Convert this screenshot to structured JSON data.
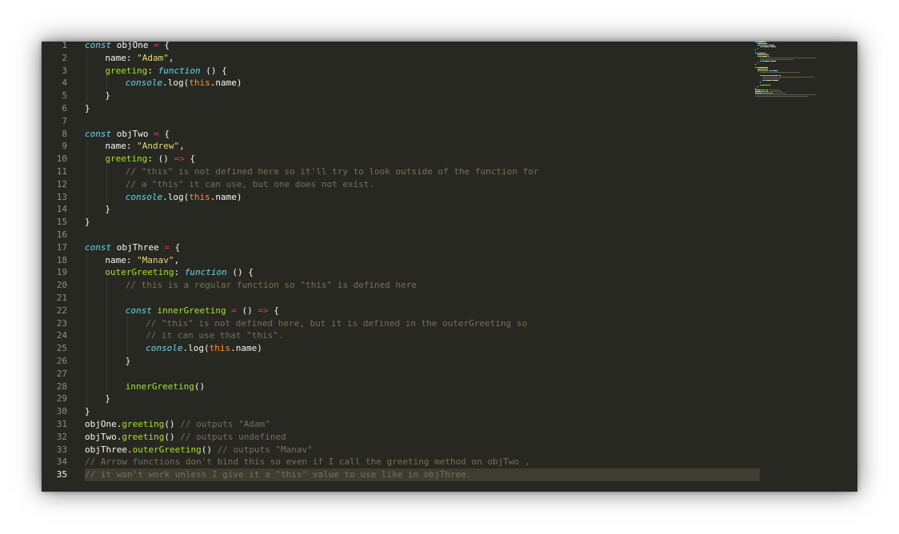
{
  "editor": {
    "current_line": 35,
    "lines": [
      {
        "n": "1",
        "indent": 0,
        "tokens": [
          [
            "kw",
            "const"
          ],
          [
            "t",
            " objOne "
          ],
          [
            "op",
            "="
          ],
          [
            "t",
            " {"
          ]
        ]
      },
      {
        "n": "2",
        "indent": 1,
        "tokens": [
          [
            "t",
            "name: "
          ],
          [
            "str",
            "\"Adam\""
          ],
          [
            "t",
            ","
          ]
        ]
      },
      {
        "n": "3",
        "indent": 1,
        "tokens": [
          [
            "prop",
            "greeting"
          ],
          [
            "t",
            ": "
          ],
          [
            "kw",
            "function"
          ],
          [
            "t",
            " () {"
          ]
        ]
      },
      {
        "n": "4",
        "indent": 2,
        "tokens": [
          [
            "con",
            "console"
          ],
          [
            "t",
            "."
          ],
          [
            "t",
            "log("
          ],
          [
            "this",
            "this"
          ],
          [
            "t",
            ".name)"
          ]
        ]
      },
      {
        "n": "5",
        "indent": 1,
        "tokens": [
          [
            "t",
            "}"
          ]
        ]
      },
      {
        "n": "6",
        "indent": 0,
        "tokens": [
          [
            "t",
            "}"
          ]
        ]
      },
      {
        "n": "7",
        "indent": 0,
        "tokens": []
      },
      {
        "n": "8",
        "indent": 0,
        "tokens": [
          [
            "kw",
            "const"
          ],
          [
            "t",
            " objTwo "
          ],
          [
            "op",
            "="
          ],
          [
            "t",
            " {"
          ]
        ]
      },
      {
        "n": "9",
        "indent": 1,
        "tokens": [
          [
            "t",
            "name: "
          ],
          [
            "str",
            "\"Andrew\""
          ],
          [
            "t",
            ","
          ]
        ]
      },
      {
        "n": "10",
        "indent": 1,
        "tokens": [
          [
            "prop",
            "greeting"
          ],
          [
            "t",
            ": () "
          ],
          [
            "op",
            "=>"
          ],
          [
            "t",
            " {"
          ]
        ]
      },
      {
        "n": "11",
        "indent": 2,
        "tokens": [
          [
            "com",
            "// \"this\" is not defined here so it'll try to look outside of the function for"
          ]
        ]
      },
      {
        "n": "12",
        "indent": 2,
        "tokens": [
          [
            "com",
            "// a \"this\" it can use, but one does not exist."
          ]
        ]
      },
      {
        "n": "13",
        "indent": 2,
        "tokens": [
          [
            "con",
            "console"
          ],
          [
            "t",
            "."
          ],
          [
            "t",
            "log("
          ],
          [
            "this",
            "this"
          ],
          [
            "t",
            ".name)"
          ]
        ]
      },
      {
        "n": "14",
        "indent": 1,
        "tokens": [
          [
            "t",
            "}"
          ]
        ]
      },
      {
        "n": "15",
        "indent": 0,
        "tokens": [
          [
            "t",
            "}"
          ]
        ]
      },
      {
        "n": "16",
        "indent": 0,
        "tokens": []
      },
      {
        "n": "17",
        "indent": 0,
        "tokens": [
          [
            "kw",
            "const"
          ],
          [
            "t",
            " objThree "
          ],
          [
            "op",
            "="
          ],
          [
            "t",
            " {"
          ]
        ]
      },
      {
        "n": "18",
        "indent": 1,
        "tokens": [
          [
            "t",
            "name: "
          ],
          [
            "str",
            "\"Manav\""
          ],
          [
            "t",
            ","
          ]
        ]
      },
      {
        "n": "19",
        "indent": 1,
        "tokens": [
          [
            "prop",
            "outerGreeting"
          ],
          [
            "t",
            ": "
          ],
          [
            "kw",
            "function"
          ],
          [
            "t",
            " () {"
          ]
        ]
      },
      {
        "n": "20",
        "indent": 2,
        "tokens": [
          [
            "com",
            "// this is a regular function so \"this\" is defined here"
          ]
        ]
      },
      {
        "n": "21",
        "indent": 0,
        "tokens": []
      },
      {
        "n": "22",
        "indent": 2,
        "tokens": [
          [
            "kw",
            "const"
          ],
          [
            "t",
            " "
          ],
          [
            "fn",
            "innerGreeting"
          ],
          [
            "t",
            " "
          ],
          [
            "op",
            "="
          ],
          [
            "t",
            " () "
          ],
          [
            "op",
            "=>"
          ],
          [
            "t",
            " {"
          ]
        ]
      },
      {
        "n": "23",
        "indent": 3,
        "tokens": [
          [
            "com",
            "// \"this\" is not defined here, but it is defined in the outerGreeting so"
          ]
        ]
      },
      {
        "n": "24",
        "indent": 3,
        "tokens": [
          [
            "com",
            "// it can use that \"this\"."
          ]
        ]
      },
      {
        "n": "25",
        "indent": 3,
        "tokens": [
          [
            "con",
            "console"
          ],
          [
            "t",
            "."
          ],
          [
            "t",
            "log("
          ],
          [
            "this",
            "this"
          ],
          [
            "t",
            ".name)"
          ]
        ]
      },
      {
        "n": "26",
        "indent": 2,
        "tokens": [
          [
            "t",
            "}"
          ]
        ]
      },
      {
        "n": "27",
        "indent": 0,
        "tokens": []
      },
      {
        "n": "28",
        "indent": 2,
        "tokens": [
          [
            "fn",
            "innerGreeting"
          ],
          [
            "t",
            "()"
          ]
        ]
      },
      {
        "n": "29",
        "indent": 1,
        "tokens": [
          [
            "t",
            "}"
          ]
        ]
      },
      {
        "n": "30",
        "indent": 0,
        "tokens": [
          [
            "t",
            "}"
          ]
        ]
      },
      {
        "n": "31",
        "indent": 0,
        "tokens": [
          [
            "t",
            "objOne."
          ],
          [
            "fn",
            "greeting"
          ],
          [
            "t",
            "() "
          ],
          [
            "com",
            "// outputs \"Adam\""
          ]
        ]
      },
      {
        "n": "32",
        "indent": 0,
        "tokens": [
          [
            "t",
            "objTwo."
          ],
          [
            "fn",
            "greeting"
          ],
          [
            "t",
            "() "
          ],
          [
            "com",
            "// outputs undefined"
          ]
        ]
      },
      {
        "n": "33",
        "indent": 0,
        "tokens": [
          [
            "t",
            "objThree."
          ],
          [
            "fn",
            "outerGreeting"
          ],
          [
            "t",
            "() "
          ],
          [
            "com",
            "// outputs \"Manav\""
          ]
        ]
      },
      {
        "n": "34",
        "indent": 0,
        "tokens": [
          [
            "com",
            "// Arrow functions don't bind this so even if I call the greeting method on objTwo ,"
          ]
        ]
      },
      {
        "n": "35",
        "indent": 0,
        "tokens": [
          [
            "com",
            "// it won't work unless I give it a \"this\" value to use like in objThree."
          ]
        ]
      }
    ]
  },
  "colors": {
    "background": "#272822",
    "keyword": "#66d9ef",
    "operator": "#f92672",
    "string": "#e6db74",
    "function": "#a6e22e",
    "comment": "#75715e",
    "this": "#fd971f",
    "text": "#f8f8f2"
  }
}
